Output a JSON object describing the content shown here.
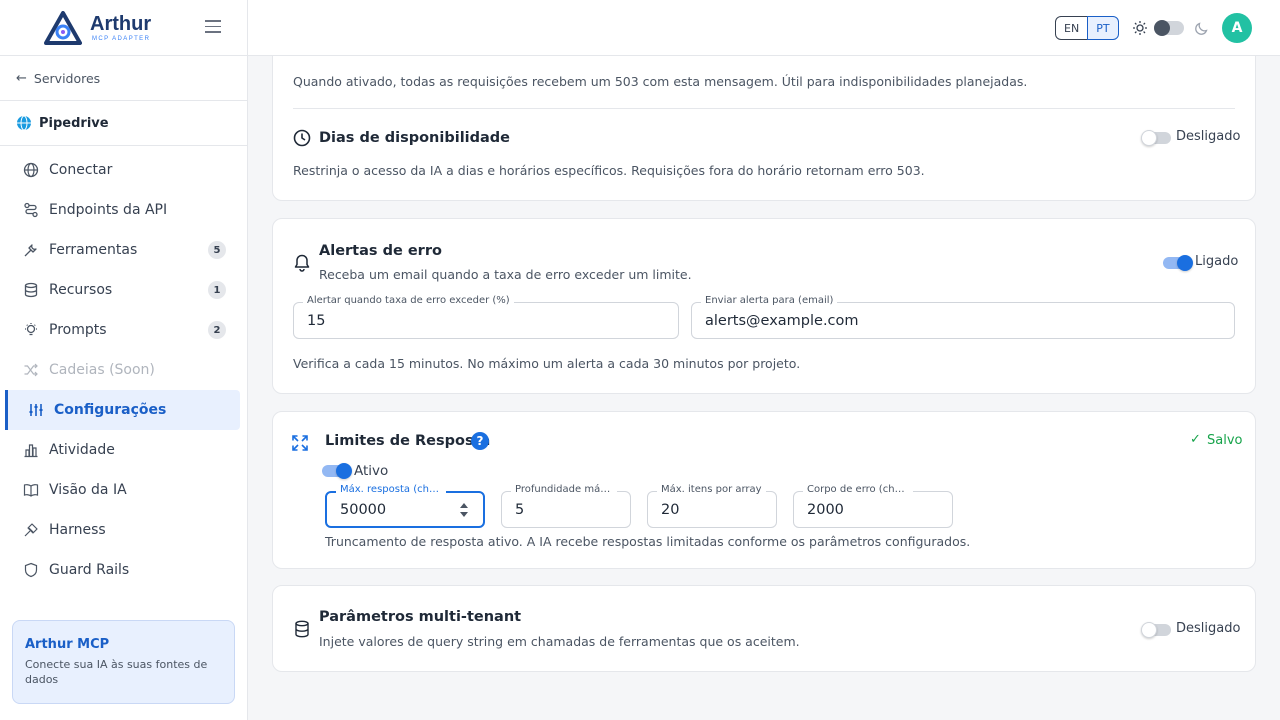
{
  "brand": {
    "name": "Arthur",
    "sub": "MCP ADAPTER"
  },
  "sidebar": {
    "back_label": "Servidores",
    "server_name": "Pipedrive",
    "items": [
      {
        "label": "Conectar",
        "icon": "globe-icon",
        "badge": null
      },
      {
        "label": "Endpoints da API",
        "icon": "endpoints-icon",
        "badge": null
      },
      {
        "label": "Ferramentas",
        "icon": "tools-icon",
        "badge": "5"
      },
      {
        "label": "Recursos",
        "icon": "database-icon",
        "badge": "1"
      },
      {
        "label": "Prompts",
        "icon": "bulb-icon",
        "badge": "2"
      },
      {
        "label": "Cadeias (Soon)",
        "icon": "shuffle-icon",
        "badge": null
      },
      {
        "label": "Configurações",
        "icon": "sliders-icon",
        "badge": null
      },
      {
        "label": "Atividade",
        "icon": "chart-icon",
        "badge": null
      },
      {
        "label": "Visão da IA",
        "icon": "book-icon",
        "badge": null
      },
      {
        "label": "Harness",
        "icon": "harness-icon",
        "badge": null
      },
      {
        "label": "Guard Rails",
        "icon": "shield-icon",
        "badge": null
      }
    ],
    "active_item": "Configurações",
    "promo": {
      "title": "Arthur MCP",
      "text": "Conecte sua IA às suas fontes de dados"
    }
  },
  "header": {
    "lang_en": "EN",
    "lang_pt": "PT",
    "avatar_initial": "A"
  },
  "maintenance": {
    "help": "Quando ativado, todas as requisições recebem um 503 com esta mensagem. Útil para indisponibilidades planejadas."
  },
  "availability": {
    "title": "Dias de disponibilidade",
    "toggle_label": "Desligado",
    "enabled": false,
    "help": "Restrinja o acesso da IA a dias e horários específicos. Requisições fora do horário retornam erro 503."
  },
  "alerts": {
    "title": "Alertas de erro",
    "subtitle": "Receba um email quando a taxa de erro exceder um limite.",
    "toggle_label": "Ligado",
    "enabled": true,
    "threshold_label": "Alertar quando taxa de erro exceder (%)",
    "threshold_value": "15",
    "email_label": "Enviar alerta para (email)",
    "email_value": "alerts@example.com",
    "help": "Verifica a cada 15 minutos. No máximo um alerta a cada 30 minutos por projeto."
  },
  "limits": {
    "title": "Limites de Resposta",
    "help_icon": "?",
    "saved_label": "Salvo",
    "active_label": "Ativo",
    "enabled": true,
    "fields": [
      {
        "label": "Máx. resposta (chars)",
        "value": "50000"
      },
      {
        "label": "Profundidade máx. de objeto",
        "value": "5"
      },
      {
        "label": "Máx. itens por array",
        "value": "20"
      },
      {
        "label": "Corpo de erro (chars)",
        "value": "2000"
      }
    ],
    "help": "Truncamento de resposta ativo. A IA recebe respostas limitadas conforme os parâmetros configurados."
  },
  "multitenant": {
    "title": "Parâmetros multi-tenant",
    "subtitle": "Injete valores de query string em chamadas de ferramentas que os aceitem.",
    "toggle_label": "Desligado",
    "enabled": false
  },
  "colors": {
    "accent": "#1a6fe0",
    "brand": "#1e3a6e",
    "avatar": "#22c1a3",
    "saved": "#16a34a"
  }
}
